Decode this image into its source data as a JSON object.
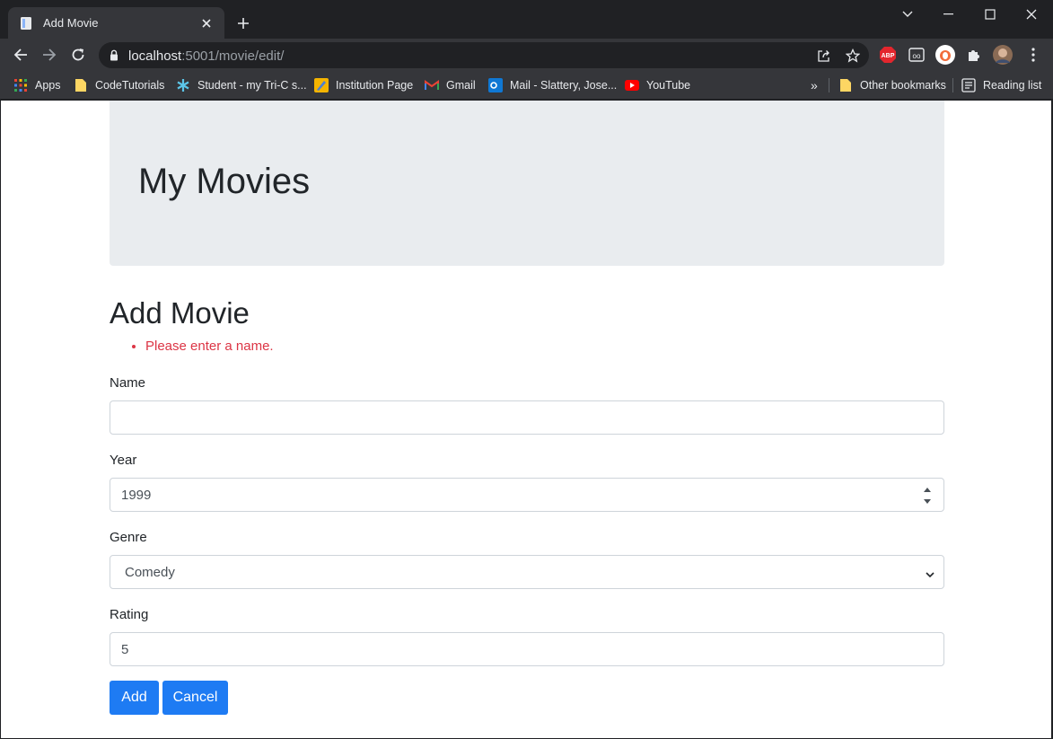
{
  "browser": {
    "tab_title": "Add Movie",
    "url_host": "localhost",
    "url_path": ":5001/movie/edit/",
    "bookmarks": [
      {
        "label": "Apps"
      },
      {
        "label": "CodeTutorials"
      },
      {
        "label": "Student - my Tri-C s..."
      },
      {
        "label": "Institution Page"
      },
      {
        "label": "Gmail"
      },
      {
        "label": "Mail - Slattery, Jose..."
      },
      {
        "label": "YouTube"
      }
    ],
    "overflow_label": "»",
    "other_bookmarks": "Other bookmarks",
    "reading_list": "Reading list",
    "extension_abp": "ABP",
    "extension_oo": "oo"
  },
  "page": {
    "site_title": "My Movies",
    "heading": "Add Movie",
    "errors": [
      "Please enter a name."
    ],
    "form": {
      "name_label": "Name",
      "name_value": "",
      "year_label": "Year",
      "year_value": "1999",
      "genre_label": "Genre",
      "genre_value": "Comedy",
      "rating_label": "Rating",
      "rating_value": "5"
    },
    "buttons": {
      "add": "Add",
      "cancel": "Cancel"
    }
  },
  "colors": {
    "chrome_dark": "#202124",
    "chrome_toolbar": "#35363a",
    "jumbotron_bg": "#e9ecef",
    "error": "#dc3545",
    "primary": "#1e7bf3"
  }
}
